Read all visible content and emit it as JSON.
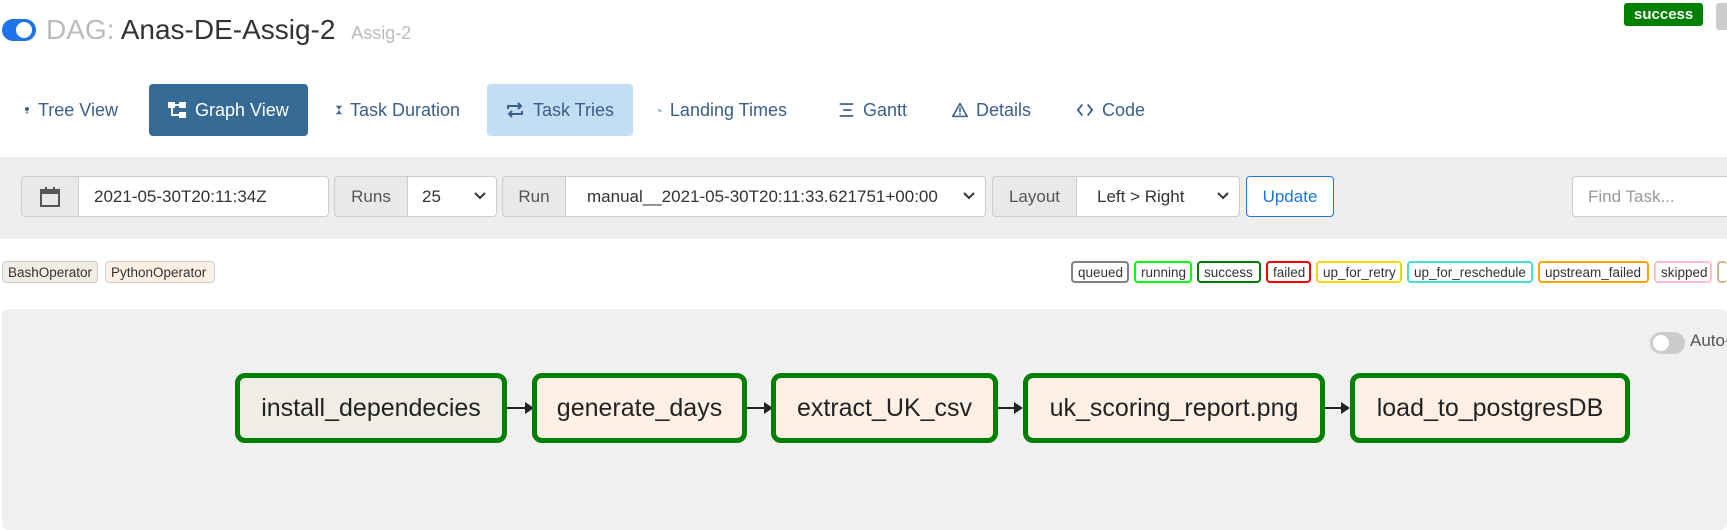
{
  "header": {
    "dag_label": "DAG:",
    "dag_id": "Anas-DE-Assig-2",
    "subtitle": "Assig-2",
    "dag_paused": false,
    "state_badge": "success",
    "state_color": "#008000"
  },
  "nav": {
    "tabs": [
      {
        "label": "Tree View",
        "icon": "tree-icon"
      },
      {
        "label": "Graph View",
        "icon": "graph-icon",
        "active": true
      },
      {
        "label": "Task Duration",
        "icon": "hourglass-icon"
      },
      {
        "label": "Task Tries",
        "icon": "retry-icon",
        "hover": true
      },
      {
        "label": "Landing Times",
        "icon": "plane-landing-icon"
      },
      {
        "label": "Gantt",
        "icon": "gantt-icon"
      },
      {
        "label": "Details",
        "icon": "warning-triangle-icon"
      },
      {
        "label": "Code",
        "icon": "code-icon"
      }
    ]
  },
  "controls": {
    "calendar_icon": "calendar-icon",
    "base_date": "2021-05-30T20:11:34Z",
    "runs_label": "Runs",
    "runs_value": "25",
    "run_label": "Run",
    "run_value": "manual__2021-05-30T20:11:33.621751+00:00",
    "layout_label": "Layout",
    "layout_value": "Left > Right",
    "update_label": "Update",
    "find_placeholder": "Find Task..."
  },
  "operators": [
    {
      "label": "BashOperator",
      "color": "#f0ede4"
    },
    {
      "label": "PythonOperator",
      "color": "#fff0e6"
    }
  ],
  "states": [
    {
      "label": "queued",
      "color": "#808080"
    },
    {
      "label": "running",
      "color": "#00ff00"
    },
    {
      "label": "success",
      "color": "#008000"
    },
    {
      "label": "failed",
      "color": "#ff0000"
    },
    {
      "label": "up_for_retry",
      "color": "#ffd700"
    },
    {
      "label": "up_for_reschedule",
      "color": "#40e0d0"
    },
    {
      "label": "upstream_failed",
      "color": "#ffa500"
    },
    {
      "label": "skipped",
      "color": "#ffc0cb"
    }
  ],
  "graph": {
    "auto_refresh_label": "Auto-",
    "tasks": [
      {
        "id": "install_dependecies",
        "operator": "BashOperator",
        "state": "success"
      },
      {
        "id": "generate_days",
        "operator": "PythonOperator",
        "state": "success"
      },
      {
        "id": "extract_UK_csv",
        "operator": "PythonOperator",
        "state": "success"
      },
      {
        "id": "uk_scoring_report.png",
        "operator": "PythonOperator",
        "state": "success"
      },
      {
        "id": "load_to_postgresDB",
        "operator": "PythonOperator",
        "state": "success"
      }
    ]
  }
}
